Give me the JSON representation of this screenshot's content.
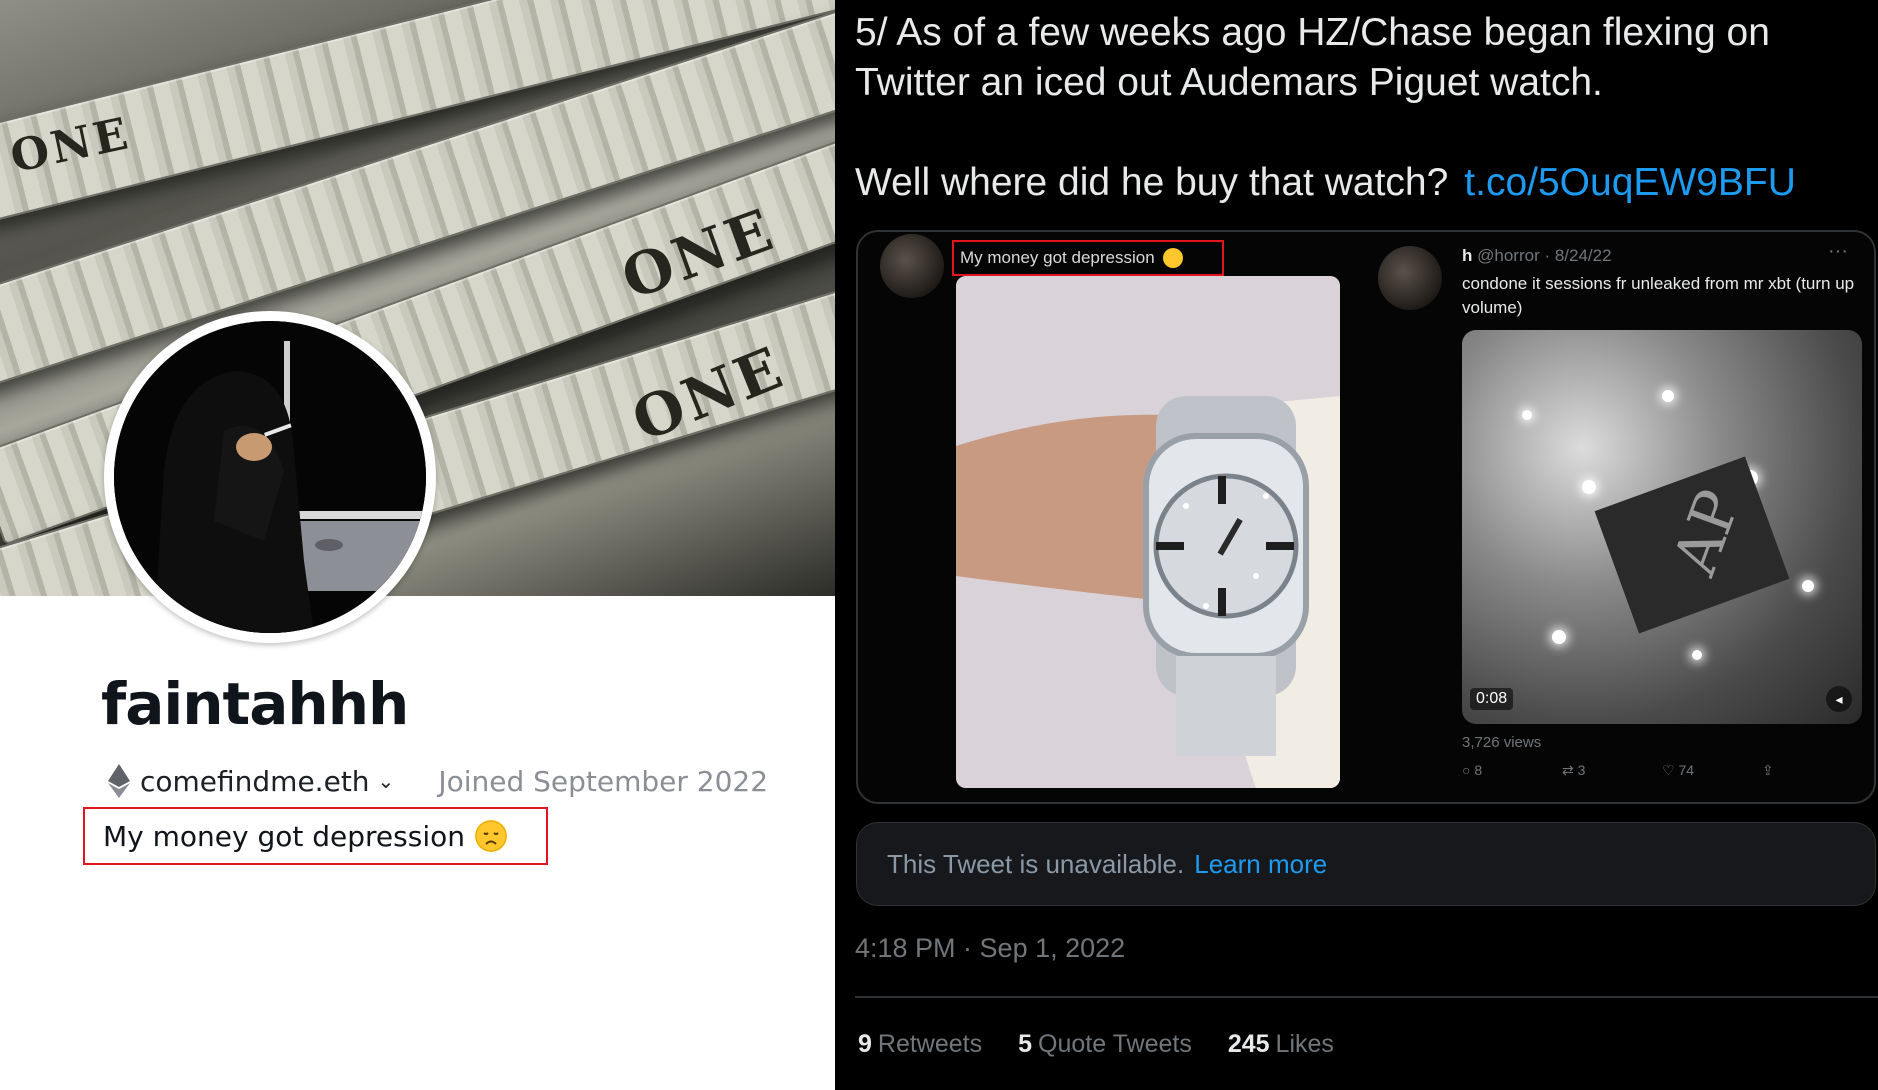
{
  "profile": {
    "display_name": "faintahhh",
    "ens_name": "comefindme.eth",
    "joined": "Joined September 2022",
    "bio": "My money got depression",
    "banner_text": [
      "ONE",
      "ONE",
      "ONE",
      "ONE"
    ]
  },
  "tweet": {
    "text_line1": "5/ As of a few weeks ago HZ/Chase began flexing on",
    "text_line2": "Twitter an iced out Audemars Piguet watch.",
    "text_line3": "Well where did he buy that watch?",
    "link": "t.co/5OuqEW9BFU",
    "quoted_caption": "My money got depression",
    "embedded": {
      "name": "h",
      "handle_date": "@horror · 8/24/22",
      "more": "···",
      "body": "condone it sessions fr unleaked from mr xbt (turn up volume)",
      "video_time": "0:08",
      "views": "3,726 views",
      "replies": "8",
      "retweets": "3",
      "likes": "74"
    },
    "unavailable_text": "This Tweet is unavailable.",
    "learn_more": "Learn more",
    "timestamp": "4:18 PM · Sep 1, 2022",
    "stats": {
      "retweets_num": "9",
      "retweets_label": "Retweets",
      "quotes_num": "5",
      "quotes_label": "Quote Tweets",
      "likes_num": "245",
      "likes_label": "Likes"
    }
  },
  "colors": {
    "highlight_box": "#e3131f",
    "link_blue": "#1d9bf0",
    "emoji_yellow": "#ffc72c"
  }
}
